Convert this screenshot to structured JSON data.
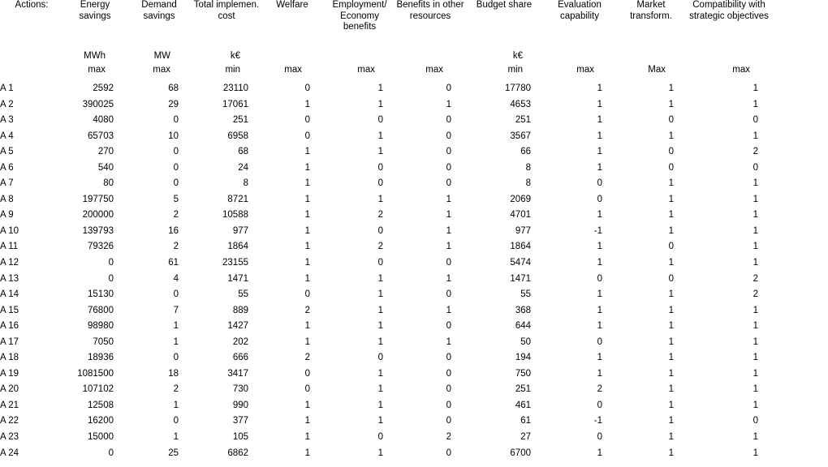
{
  "table": {
    "corner_label": "Actions:",
    "columns": [
      {
        "key": "energy_savings",
        "header": "Energy savings",
        "unit": "MWh",
        "goal": "max"
      },
      {
        "key": "demand_savings",
        "header": "Demand savings",
        "unit": "MW",
        "goal": "max"
      },
      {
        "key": "total_impl_cost",
        "header": "Total implemen. cost",
        "unit": "k€",
        "goal": "min"
      },
      {
        "key": "welfare",
        "header": "Welfare",
        "unit": "",
        "goal": "max"
      },
      {
        "key": "employment",
        "header": "Employment/ Economy benefits",
        "unit": "",
        "goal": "max"
      },
      {
        "key": "other_benefits",
        "header": "Benefits in other resources",
        "unit": "",
        "goal": "max"
      },
      {
        "key": "budget_share",
        "header": "Budget share",
        "unit": "k€",
        "goal": "min"
      },
      {
        "key": "evaluation",
        "header": "Evaluation capability",
        "unit": "",
        "goal": "max"
      },
      {
        "key": "market",
        "header": "Market transform.",
        "unit": "",
        "goal": "Max"
      },
      {
        "key": "compatibility",
        "header": "Compatibility with strategic objectives",
        "unit": "",
        "goal": "max"
      }
    ],
    "rows": [
      {
        "label": "A 1",
        "values": [
          "2592",
          "68",
          "23110",
          "0",
          "1",
          "0",
          "17780",
          "1",
          "1",
          "1"
        ]
      },
      {
        "label": "A 2",
        "values": [
          "390025",
          "29",
          "17061",
          "1",
          "1",
          "1",
          "4653",
          "1",
          "1",
          "1"
        ]
      },
      {
        "label": "A 3",
        "values": [
          "4080",
          "0",
          "251",
          "0",
          "0",
          "0",
          "251",
          "1",
          "0",
          "0"
        ]
      },
      {
        "label": "A 4",
        "values": [
          "65703",
          "10",
          "6958",
          "0",
          "1",
          "0",
          "3567",
          "1",
          "1",
          "1"
        ]
      },
      {
        "label": "A 5",
        "values": [
          "270",
          "0",
          "68",
          "1",
          "1",
          "0",
          "66",
          "1",
          "0",
          "2"
        ]
      },
      {
        "label": "A 6",
        "values": [
          "540",
          "0",
          "24",
          "1",
          "0",
          "0",
          "8",
          "1",
          "0",
          "0"
        ]
      },
      {
        "label": "A 7",
        "values": [
          "80",
          "0",
          "8",
          "1",
          "0",
          "0",
          "8",
          "0",
          "1",
          "1"
        ]
      },
      {
        "label": "A 8",
        "values": [
          "197750",
          "5",
          "8721",
          "1",
          "1",
          "1",
          "2069",
          "0",
          "1",
          "1"
        ]
      },
      {
        "label": "A 9",
        "values": [
          "200000",
          "2",
          "10588",
          "1",
          "2",
          "1",
          "4701",
          "1",
          "1",
          "1"
        ]
      },
      {
        "label": "A 10",
        "values": [
          "139793",
          "16",
          "977",
          "1",
          "0",
          "1",
          "977",
          "-1",
          "1",
          "1"
        ]
      },
      {
        "label": "A 11",
        "values": [
          "79326",
          "2",
          "1864",
          "1",
          "2",
          "1",
          "1864",
          "1",
          "0",
          "1"
        ]
      },
      {
        "label": "A 12",
        "values": [
          "0",
          "61",
          "23155",
          "1",
          "0",
          "0",
          "5474",
          "1",
          "1",
          "1"
        ]
      },
      {
        "label": "A 13",
        "values": [
          "0",
          "4",
          "1471",
          "1",
          "1",
          "1",
          "1471",
          "0",
          "0",
          "2"
        ]
      },
      {
        "label": "A 14",
        "values": [
          "15130",
          "0",
          "55",
          "0",
          "1",
          "0",
          "55",
          "1",
          "1",
          "2"
        ]
      },
      {
        "label": "A 15",
        "values": [
          "76800",
          "7",
          "889",
          "2",
          "1",
          "1",
          "368",
          "1",
          "1",
          "1"
        ]
      },
      {
        "label": "A 16",
        "values": [
          "98980",
          "1",
          "1427",
          "1",
          "1",
          "0",
          "644",
          "1",
          "1",
          "1"
        ]
      },
      {
        "label": "A 17",
        "values": [
          "7050",
          "1",
          "202",
          "1",
          "1",
          "1",
          "50",
          "0",
          "1",
          "1"
        ]
      },
      {
        "label": "A 18",
        "values": [
          "18936",
          "0",
          "666",
          "2",
          "0",
          "0",
          "194",
          "1",
          "1",
          "1"
        ]
      },
      {
        "label": "A 19",
        "values": [
          "1081500",
          "18",
          "3417",
          "0",
          "1",
          "0",
          "750",
          "1",
          "1",
          "1"
        ]
      },
      {
        "label": "A 20",
        "values": [
          "107102",
          "2",
          "730",
          "0",
          "1",
          "0",
          "251",
          "2",
          "1",
          "1"
        ]
      },
      {
        "label": "A 21",
        "values": [
          "12508",
          "1",
          "990",
          "1",
          "1",
          "0",
          "461",
          "0",
          "1",
          "1"
        ]
      },
      {
        "label": "A 22",
        "values": [
          "16200",
          "0",
          "377",
          "1",
          "1",
          "0",
          "61",
          "-1",
          "1",
          "0"
        ]
      },
      {
        "label": "A 23",
        "values": [
          "15000",
          "1",
          "105",
          "1",
          "0",
          "2",
          "27",
          "0",
          "1",
          "1"
        ]
      },
      {
        "label": "A 24",
        "values": [
          "0",
          "25",
          "6862",
          "1",
          "1",
          "0",
          "6700",
          "1",
          "1",
          "1"
        ]
      }
    ]
  }
}
